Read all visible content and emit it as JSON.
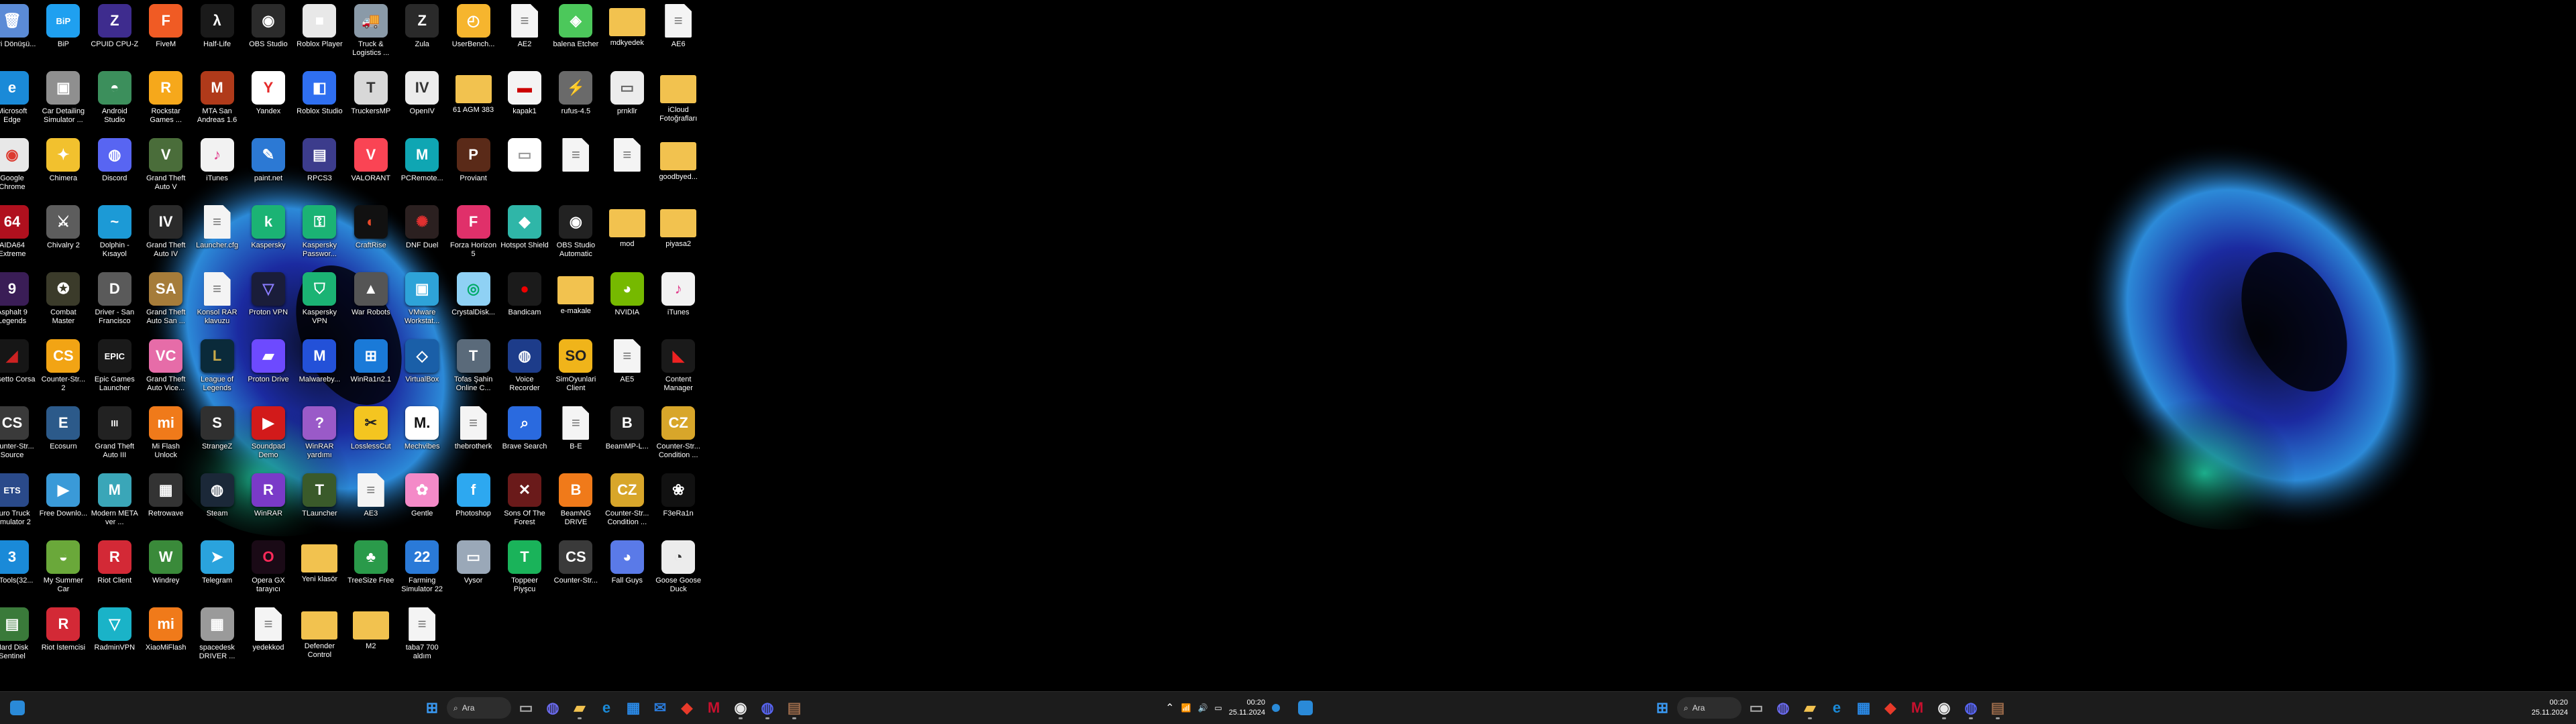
{
  "colors": {
    "taskbar": "#1c1c1c",
    "desktop": "#000000",
    "accent": "#0a78d4"
  },
  "desktop": {
    "icons": [
      {
        "label": "Geri Dönüşü...",
        "icon": "recycle-bin-icon",
        "bg": "#5b8bd6",
        "g": "🗑"
      },
      {
        "label": "BiP",
        "icon": "bip-icon",
        "bg": "#1fa0f0",
        "g": "BiP"
      },
      {
        "label": "CPUID CPU-Z",
        "icon": "cpuz-icon",
        "bg": "#3e2c8e",
        "g": "Z"
      },
      {
        "label": "FiveM",
        "icon": "fivem-icon",
        "bg": "#f05b24",
        "g": "F"
      },
      {
        "label": "Half-Life",
        "icon": "half-life-icon",
        "bg": "#1a1a1a",
        "g": "λ"
      },
      {
        "label": "OBS Studio",
        "icon": "obs-icon",
        "bg": "#2b2b2b",
        "g": "◉"
      },
      {
        "label": "Roblox Player",
        "icon": "roblox-icon",
        "bg": "#e8e8e8",
        "g": "■"
      },
      {
        "label": "Truck & Logistics ...",
        "icon": "truck-icon",
        "bg": "#8a9aa8",
        "g": "🚚"
      },
      {
        "label": "Zula",
        "icon": "zula-icon",
        "bg": "#2a2a2a",
        "g": "Z"
      },
      {
        "label": "UserBench...",
        "icon": "userbench-icon",
        "bg": "#f6b52e",
        "g": "◴"
      },
      {
        "label": "AE2",
        "icon": "file-icon",
        "type": "file"
      },
      {
        "label": "balena Etcher",
        "icon": "etcher-icon",
        "bg": "#4cc85b",
        "g": "◈"
      },
      {
        "label": "mdkyedek",
        "icon": "folder-icon",
        "type": "folder"
      },
      {
        "label": "AE6",
        "icon": "file-icon",
        "type": "file"
      },
      {
        "label": "Microsoft Edge",
        "icon": "edge-icon",
        "bg": "#1a8ad8",
        "g": "e"
      },
      {
        "label": "Car Detailing Simulator ...",
        "icon": "car-detailing-icon",
        "bg": "#8f8f8f",
        "g": "▣"
      },
      {
        "label": "Android Studio",
        "icon": "android-studio-icon",
        "bg": "#3c8f5c",
        "g": "◓"
      },
      {
        "label": "Rockstar Games ...",
        "icon": "rockstar-icon",
        "bg": "#f6a81b",
        "g": "R"
      },
      {
        "label": "MTA San Andreas 1.6",
        "icon": "mta-icon",
        "bg": "#b03a1a",
        "g": "M"
      },
      {
        "label": "Yandex",
        "icon": "yandex-icon",
        "bg": "#ffffff",
        "g": "Y",
        "fg": "#e52a2a"
      },
      {
        "label": "Roblox Studio",
        "icon": "roblox-studio-icon",
        "bg": "#2f6ff0",
        "g": "◧"
      },
      {
        "label": "TruckersMP",
        "icon": "truckersmp-icon",
        "bg": "#d8d8d8",
        "g": "T",
        "fg": "#333"
      },
      {
        "label": "OpenIV",
        "icon": "openiv-icon",
        "bg": "#ececec",
        "g": "IV",
        "fg": "#333"
      },
      {
        "label": "61 AGM 383",
        "icon": "folder-icon",
        "type": "folder"
      },
      {
        "label": "kapak1",
        "icon": "image-file-icon",
        "bg": "#f4f4f4",
        "g": "▬",
        "fg": "#c00"
      },
      {
        "label": "rufus-4.5",
        "icon": "rufus-icon",
        "bg": "#6a6a6a",
        "g": "⚡"
      },
      {
        "label": "prnkllr",
        "icon": "image-file-icon",
        "bg": "#ececec",
        "g": "▭",
        "fg": "#666"
      },
      {
        "label": "iCloud Fotoğrafları",
        "icon": "icloud-folder-icon",
        "type": "folder"
      },
      {
        "label": "Google Chrome",
        "icon": "chrome-icon",
        "bg": "#e8e8e8",
        "g": "◉",
        "fg": "#dc3a2f"
      },
      {
        "label": "Chimera",
        "icon": "chimera-icon",
        "bg": "#f2c12e",
        "g": "✦"
      },
      {
        "label": "Discord",
        "icon": "discord-icon",
        "bg": "#5865f2",
        "g": "◍"
      },
      {
        "label": "Grand Theft Auto V",
        "icon": "gta5-icon",
        "bg": "#4a6d3a",
        "g": "V"
      },
      {
        "label": "iTunes",
        "icon": "itunes-icon",
        "bg": "#f2f2f2",
        "g": "♪",
        "fg": "#e03a8a"
      },
      {
        "label": "paint.net",
        "icon": "paintnet-icon",
        "bg": "#2c79d4",
        "g": "✎"
      },
      {
        "label": "RPCS3",
        "icon": "rpcs3-icon",
        "bg": "#3c3c8c",
        "g": "▤"
      },
      {
        "label": "VALORANT",
        "icon": "valorant-icon",
        "bg": "#fa4454",
        "g": "V"
      },
      {
        "label": "PCRemote...",
        "icon": "pcremote-icon",
        "bg": "#0fa6b3",
        "g": "M"
      },
      {
        "label": "Proviant",
        "icon": "proviant-icon",
        "bg": "#5a2a18",
        "g": "P"
      },
      {
        "label": "",
        "icon": "image-file-icon",
        "bg": "#ffffff",
        "g": "▭",
        "fg": "#999"
      },
      {
        "label": "",
        "icon": "file-icon",
        "type": "file"
      },
      {
        "label": "",
        "icon": "file-icon",
        "type": "file"
      },
      {
        "label": "goodbyed...",
        "icon": "folder-icon",
        "type": "folder"
      },
      {
        "label": "AIDA64 Extreme",
        "icon": "aida64-icon",
        "bg": "#b0101e",
        "g": "64"
      },
      {
        "label": "Chivalry 2",
        "icon": "chivalry-icon",
        "bg": "#5d5d5d",
        "g": "⚔"
      },
      {
        "label": "Dolphin - Kısayol",
        "icon": "dolphin-icon",
        "bg": "#1c9ad6",
        "g": "~"
      },
      {
        "label": "Grand Theft Auto IV",
        "icon": "gta4-icon",
        "bg": "#2a2a2a",
        "g": "IV"
      },
      {
        "label": "Launcher.cfg",
        "icon": "file-icon",
        "type": "file"
      },
      {
        "label": "Kaspersky",
        "icon": "kaspersky-icon",
        "bg": "#1bb374",
        "g": "k"
      },
      {
        "label": "Kaspersky Passwor...",
        "icon": "kaspersky-password-icon",
        "bg": "#1bb374",
        "g": "⚿"
      },
      {
        "label": "CraftRise",
        "icon": "craftrise-icon",
        "bg": "#111",
        "g": "◐",
        "fg": "#e84a2a"
      },
      {
        "label": "DNF Duel",
        "icon": "dnf-icon",
        "bg": "#2b2020",
        "g": "✺",
        "fg": "#e03030"
      },
      {
        "label": "Forza Horizon 5",
        "icon": "forza-icon",
        "bg": "#e0306a",
        "g": "F"
      },
      {
        "label": "Hotspot Shield",
        "icon": "hotspot-icon",
        "bg": "#2fb6a8",
        "g": "◆"
      },
      {
        "label": "OBS Studio Automatic",
        "icon": "obs-icon",
        "bg": "#222",
        "g": "◉"
      },
      {
        "label": "mod",
        "icon": "folder-icon",
        "type": "folder"
      },
      {
        "label": "piyasa2",
        "icon": "folder-icon",
        "type": "folder"
      },
      {
        "label": "Asphalt 9 Legends",
        "icon": "asphalt-icon",
        "bg": "#3a1d56",
        "g": "9"
      },
      {
        "label": "Combat Master",
        "icon": "combat-master-icon",
        "bg": "#3b3b2a",
        "g": "✪"
      },
      {
        "label": "Driver - San Francisco",
        "icon": "driver-icon",
        "bg": "#5a5a5a",
        "g": "D"
      },
      {
        "label": "Grand Theft Auto San ...",
        "icon": "gtasa-icon",
        "bg": "#a57c3a",
        "g": "SA"
      },
      {
        "label": "Konsol RAR klavuzu",
        "icon": "file-icon",
        "type": "file"
      },
      {
        "label": "Proton VPN",
        "icon": "protonvpn-icon",
        "bg": "#1a1d3a",
        "g": "▽",
        "fg": "#8a7cff"
      },
      {
        "label": "Kaspersky VPN",
        "icon": "kaspersky-vpn-icon",
        "bg": "#1bb374",
        "g": "⛉"
      },
      {
        "label": "War Robots",
        "icon": "war-robots-icon",
        "bg": "#555",
        "g": "▲"
      },
      {
        "label": "VMware Workstat...",
        "icon": "vmware-icon",
        "bg": "#2ea3d8",
        "g": "▣"
      },
      {
        "label": "CrystalDisk...",
        "icon": "crystaldisk-icon",
        "bg": "#8fd1f4",
        "g": "◎",
        "fg": "#0a6"
      },
      {
        "label": "Bandicam",
        "icon": "bandicam-icon",
        "bg": "#1b1b1b",
        "g": "●",
        "fg": "#e00"
      },
      {
        "label": "e-makale",
        "icon": "folder-icon",
        "type": "folder"
      },
      {
        "label": "NVIDIA",
        "icon": "nvidia-icon",
        "bg": "#76b900",
        "g": "◕"
      },
      {
        "label": "iTunes",
        "icon": "itunes-icon",
        "bg": "#f2f2f2",
        "g": "♪",
        "fg": "#e03a8a"
      },
      {
        "label": "Assetto Corsa",
        "icon": "assetto-corsa-icon",
        "bg": "#161616",
        "g": "◢",
        "fg": "#c22"
      },
      {
        "label": "Counter-Str... 2",
        "icon": "cs2-icon",
        "bg": "#f2a414",
        "g": "CS"
      },
      {
        "label": "Epic Games Launcher",
        "icon": "epic-icon",
        "bg": "#1a1a1a",
        "g": "EPIC"
      },
      {
        "label": "Grand Theft Auto Vice...",
        "icon": "gtavc-icon",
        "bg": "#e66ca8",
        "g": "VC"
      },
      {
        "label": "League of Legends",
        "icon": "lol-icon",
        "bg": "#0a2a3a",
        "g": "L",
        "fg": "#c9aa4a"
      },
      {
        "label": "Proton Drive",
        "icon": "proton-drive-icon",
        "bg": "#6d4aff",
        "g": "▰"
      },
      {
        "label": "Malwareby...",
        "icon": "malwarebytes-icon",
        "bg": "#2351d8",
        "g": "M"
      },
      {
        "label": "WinRa1n2.1",
        "icon": "winra1n-icon",
        "bg": "#1a7ad8",
        "g": "⊞"
      },
      {
        "label": "VirtualBox",
        "icon": "virtualbox-icon",
        "bg": "#1a5fa8",
        "g": "◇"
      },
      {
        "label": "Tofas Şahin Online C...",
        "icon": "tofas-icon",
        "bg": "#5a6a7a",
        "g": "T"
      },
      {
        "label": "Voice Recorder",
        "icon": "voice-recorder-icon",
        "bg": "#1d3c8a",
        "g": "◍"
      },
      {
        "label": "SimOyunlari Client",
        "icon": "simoyunlari-icon",
        "bg": "#f0b41a",
        "g": "SO",
        "fg": "#222"
      },
      {
        "label": "AE5",
        "icon": "file-icon",
        "type": "file"
      },
      {
        "label": "Content Manager",
        "icon": "content-manager-icon",
        "bg": "#1a1a1a",
        "g": "◣",
        "fg": "#e22"
      },
      {
        "label": "Counter-Str... Source",
        "icon": "css-icon",
        "bg": "#3a3a3a",
        "g": "CS"
      },
      {
        "label": "Ecosurn",
        "icon": "ecosurn-icon",
        "bg": "#2c5a8a",
        "g": "E"
      },
      {
        "label": "Grand Theft Auto III",
        "icon": "gta3-icon",
        "bg": "#222",
        "g": "III"
      },
      {
        "label": "Mi Flash Unlock",
        "icon": "mi-flash-icon",
        "bg": "#f07a1a",
        "g": "mi"
      },
      {
        "label": "StrangeZ",
        "icon": "strangez-icon",
        "bg": "#303030",
        "g": "S"
      },
      {
        "label": "Soundpad Demo",
        "icon": "soundpad-icon",
        "bg": "#d21a1a",
        "g": "▶"
      },
      {
        "label": "WinRAR yardımı",
        "icon": "winrar-help-icon",
        "bg": "#9a5ac8",
        "g": "?"
      },
      {
        "label": "LosslessCut",
        "icon": "losslesscut-icon",
        "bg": "#f4c520",
        "g": "✂",
        "fg": "#222"
      },
      {
        "label": "Mechvibes",
        "icon": "mechvibes-icon",
        "bg": "#ffffff",
        "g": "M.",
        "fg": "#111"
      },
      {
        "label": "thebrotherk",
        "icon": "file-icon",
        "type": "file"
      },
      {
        "label": "Brave Search",
        "icon": "search-app-icon",
        "bg": "#2a6adf",
        "g": "⌕"
      },
      {
        "label": "B-E",
        "icon": "file-icon",
        "type": "file"
      },
      {
        "label": "BeamMP-L...",
        "icon": "beammp-icon",
        "bg": "#222",
        "g": "B"
      },
      {
        "label": "Counter-Str... Condition ...",
        "icon": "cscz-icon",
        "bg": "#d8a62a",
        "g": "CZ"
      },
      {
        "label": "Euro Truck Simulator 2",
        "icon": "ets2-icon",
        "bg": "#2a4a8a",
        "g": "ETS"
      },
      {
        "label": "Free Downlo...",
        "icon": "fdm-icon",
        "bg": "#3a9ad8",
        "g": "▶"
      },
      {
        "label": "Modern META ver ...",
        "icon": "modern-meta-icon",
        "bg": "#3aa6b8",
        "g": "M"
      },
      {
        "label": "Retrowave",
        "icon": "retrowave-icon",
        "bg": "#333",
        "g": "▦"
      },
      {
        "label": "Steam",
        "icon": "steam-icon",
        "bg": "#1b2838",
        "g": "◍"
      },
      {
        "label": "WinRAR",
        "icon": "winrar-icon",
        "bg": "#7a3ac8",
        "g": "R"
      },
      {
        "label": "TLauncher",
        "icon": "tlauncher-icon",
        "bg": "#3a5a2a",
        "g": "T"
      },
      {
        "label": "AE3",
        "icon": "file-icon",
        "type": "file"
      },
      {
        "label": "Gentle",
        "icon": "gentle-icon",
        "bg": "#f48ac8",
        "g": "✿"
      },
      {
        "label": "Photoshop",
        "icon": "photoshop-icon",
        "bg": "#2da8f0",
        "g": "f"
      },
      {
        "label": "Sons Of The Forest",
        "icon": "sons-forest-icon",
        "bg": "#6a1a1a",
        "g": "✕"
      },
      {
        "label": "BeamNG DRIVE",
        "icon": "beamng-icon",
        "bg": "#f07a1a",
        "g": "B"
      },
      {
        "label": "Counter-Str... Condition ...",
        "icon": "cscz-icon",
        "bg": "#d8a62a",
        "g": "CZ"
      },
      {
        "label": "F3eRa1n",
        "icon": "f3era1n-icon",
        "bg": "#111",
        "g": "❀"
      },
      {
        "label": "3uTools(32...",
        "icon": "3utools-icon",
        "bg": "#1a8ad8",
        "g": "3"
      },
      {
        "label": "My Summer Car",
        "icon": "my-summer-car-icon",
        "bg": "#6aa83a",
        "g": "◒"
      },
      {
        "label": "Riot Client",
        "icon": "riot-client-icon",
        "bg": "#d32936",
        "g": "R"
      },
      {
        "label": "Windrey",
        "icon": "windrey-icon",
        "bg": "#3a8a3a",
        "g": "W"
      },
      {
        "label": "Telegram",
        "icon": "telegram-icon",
        "bg": "#2aa3dd",
        "g": "➤"
      },
      {
        "label": "Opera GX tarayıcı",
        "icon": "opera-gx-icon",
        "bg": "#1a0a16",
        "g": "O",
        "fg": "#ff2a5a"
      },
      {
        "label": "Yeni klasör",
        "icon": "folder-icon",
        "type": "folder"
      },
      {
        "label": "TreeSize Free",
        "icon": "treesize-icon",
        "bg": "#2a9a4a",
        "g": "♣"
      },
      {
        "label": "Farming Simulator 22",
        "icon": "farming-sim-icon",
        "bg": "#2a7ad8",
        "g": "22"
      },
      {
        "label": "Vysor",
        "icon": "vysor-icon",
        "bg": "#9aa8b8",
        "g": "▭"
      },
      {
        "label": "Toppeer Piyşcu",
        "icon": "topper-icon",
        "bg": "#1ab35a",
        "g": "T"
      },
      {
        "label": "Counter-Str...",
        "icon": "cs-icon",
        "bg": "#3a3a3a",
        "g": "CS"
      },
      {
        "label": "Fall Guys",
        "icon": "fall-guys-icon",
        "bg": "#5a7ae8",
        "g": "◕"
      },
      {
        "label": "Goose Goose Duck",
        "icon": "goose-icon",
        "bg": "#ececec",
        "g": "◔",
        "fg": "#333"
      },
      {
        "label": "Hard Disk Sentinel",
        "icon": "hd-sentinel-icon",
        "bg": "#3a7a3a",
        "g": "▤"
      },
      {
        "label": "Riot İstemcisi",
        "icon": "riot-client-icon",
        "bg": "#d32936",
        "g": "R"
      },
      {
        "label": "RadminVPN",
        "icon": "radmin-icon",
        "bg": "#1ab3c8",
        "g": "▽"
      },
      {
        "label": "XiaoMiFlash",
        "icon": "xiaomiflash-icon",
        "bg": "#f07a1a",
        "g": "mi"
      },
      {
        "label": "spacedesk DRIVER ...",
        "icon": "spacedesk-icon",
        "bg": "#9a9a9a",
        "g": "▦"
      },
      {
        "label": "yedekkod",
        "icon": "file-icon",
        "type": "file"
      },
      {
        "label": "Defender Control",
        "icon": "folder-icon",
        "type": "folder"
      },
      {
        "label": "M2",
        "icon": "folder-icon",
        "type": "folder"
      },
      {
        "label": "taba7 700 aldım",
        "icon": "file-icon",
        "type": "file"
      }
    ]
  },
  "taskbar_left": {
    "search_label": "Ara",
    "items": [
      {
        "icon": "start-icon",
        "c": "#3a9af4",
        "g": "⊞"
      },
      {
        "icon": "search-icon",
        "type": "search"
      },
      {
        "icon": "task-view-icon",
        "c": "#aaa",
        "g": "▭"
      },
      {
        "icon": "chat-icon",
        "c": "#6a6aee",
        "g": "◍"
      },
      {
        "icon": "file-explorer-icon",
        "c": "#f2c24f",
        "g": "▰",
        "active": true
      },
      {
        "icon": "edge-icon",
        "c": "#1a8ad8",
        "g": "e"
      },
      {
        "icon": "store-icon",
        "c": "#2a8ae8",
        "g": "▦"
      },
      {
        "icon": "mail-icon",
        "c": "#2a7ad8",
        "g": "✉"
      },
      {
        "icon": "anydesk-icon",
        "c": "#e83a2a",
        "g": "◆"
      },
      {
        "icon": "mcafee-icon",
        "c": "#c8102e",
        "g": "M"
      },
      {
        "icon": "chrome-icon",
        "c": "#e8e8e8",
        "g": "◉",
        "active": true
      },
      {
        "icon": "discord-icon",
        "c": "#5865f2",
        "g": "◍",
        "active": true
      },
      {
        "icon": "app-icon",
        "c": "#9a6a4a",
        "g": "▤",
        "active": true
      }
    ],
    "tray": {
      "chevron": "⌃",
      "wifi": "📶",
      "volume": "🔊",
      "battery": "▭"
    },
    "time": "00:20",
    "date": "25.11.2024"
  },
  "taskbar_right": {
    "search_label": "Ara",
    "items": [
      {
        "icon": "start-icon",
        "c": "#3a9af4",
        "g": "⊞"
      },
      {
        "icon": "search-icon",
        "type": "search"
      },
      {
        "icon": "task-view-icon",
        "c": "#aaa",
        "g": "▭"
      },
      {
        "icon": "chat-icon",
        "c": "#6a6aee",
        "g": "◍"
      },
      {
        "icon": "file-explorer-icon",
        "c": "#f2c24f",
        "g": "▰",
        "active": true
      },
      {
        "icon": "edge-icon",
        "c": "#1a8ad8",
        "g": "e"
      },
      {
        "icon": "store-icon",
        "c": "#2a8ae8",
        "g": "▦"
      },
      {
        "icon": "anydesk-icon",
        "c": "#e83a2a",
        "g": "◆"
      },
      {
        "icon": "mcafee-icon",
        "c": "#c8102e",
        "g": "M"
      },
      {
        "icon": "chrome-icon",
        "c": "#e8e8e8",
        "g": "◉",
        "active": true
      },
      {
        "icon": "discord-icon",
        "c": "#5865f2",
        "g": "◍",
        "active": true
      },
      {
        "icon": "app-icon",
        "c": "#9a6a4a",
        "g": "▤",
        "active": true
      }
    ],
    "time": "00:20",
    "date": "25.11.2024"
  }
}
